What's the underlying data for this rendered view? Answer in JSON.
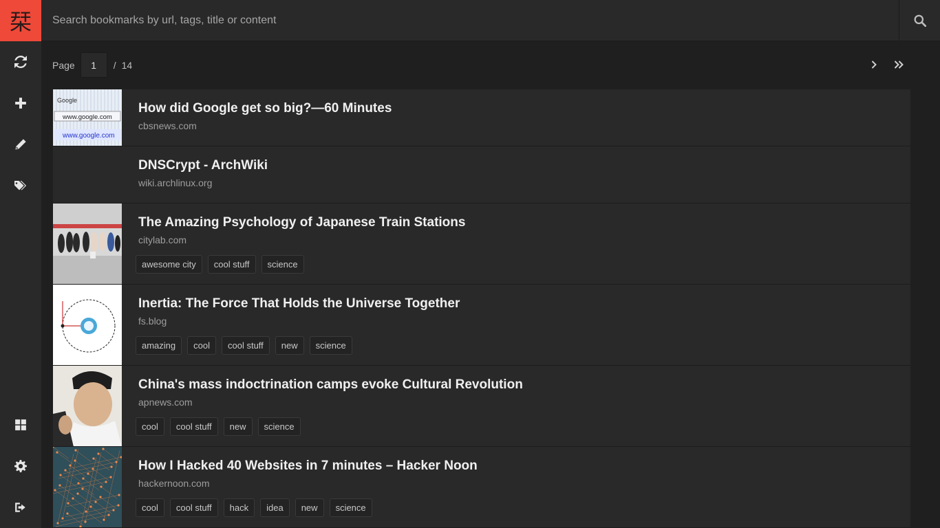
{
  "logo": {
    "glyph": "栞"
  },
  "search": {
    "placeholder": "Search bookmarks by url, tags, title or content"
  },
  "sidebar": {
    "top_items": [
      {
        "name": "refresh-icon"
      },
      {
        "name": "add-icon"
      },
      {
        "name": "edit-icon"
      },
      {
        "name": "tags-icon"
      }
    ],
    "bottom_items": [
      {
        "name": "grid-icon"
      },
      {
        "name": "settings-icon"
      },
      {
        "name": "logout-icon"
      }
    ]
  },
  "pagination": {
    "label": "Page",
    "current": "1",
    "separator": "/",
    "total": "14"
  },
  "bookmarks": [
    {
      "title": "How did Google get so big?—60 Minutes",
      "url": "cbsnews.com",
      "thumb": "google",
      "tags": []
    },
    {
      "title": "DNSCrypt - ArchWiki",
      "url": "wiki.archlinux.org",
      "thumb": "none",
      "tags": []
    },
    {
      "title": "The Amazing Psychology of Japanese Train Stations",
      "url": "citylab.com",
      "thumb": "train",
      "tags": [
        "awesome city",
        "cool stuff",
        "science"
      ]
    },
    {
      "title": "Inertia: The Force That Holds the Universe Together",
      "url": "fs.blog",
      "thumb": "orbit",
      "tags": [
        "amazing",
        "cool",
        "cool stuff",
        "new",
        "science"
      ]
    },
    {
      "title": "China's mass indoctrination camps evoke Cultural Revolution",
      "url": "apnews.com",
      "thumb": "portrait",
      "tags": [
        "cool",
        "cool stuff",
        "new",
        "science"
      ]
    },
    {
      "title": "How I Hacked 40 Websites in 7 minutes – Hacker Noon",
      "url": "hackernoon.com",
      "thumb": "network",
      "tags": [
        "cool",
        "cool stuff",
        "hack",
        "idea",
        "new",
        "science"
      ]
    }
  ],
  "colors": {
    "accent": "#ef4939",
    "sidebar": "#292929",
    "background": "#1f1f1f"
  }
}
